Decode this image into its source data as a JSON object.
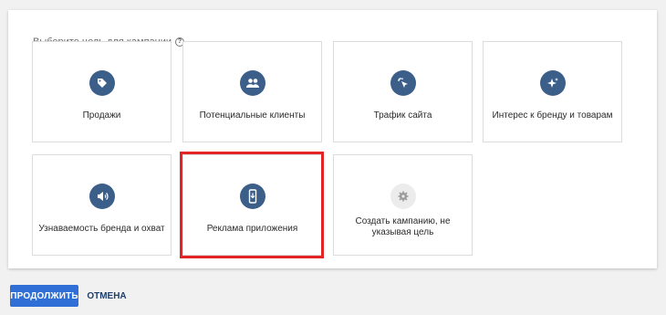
{
  "heading": "Выберите цель для кампании",
  "help_icon": "help-circle-icon",
  "cards": [
    {
      "label": "Продажи",
      "icon": "tag-icon"
    },
    {
      "label": "Потенциальные клиенты",
      "icon": "people-icon"
    },
    {
      "label": "Трафик сайта",
      "icon": "cursor-click-icon"
    },
    {
      "label": "Интерес к бренду и товарам",
      "icon": "sparkle-icon"
    },
    {
      "label": "Узнаваемость бренда и охват",
      "icon": "megaphone-icon"
    },
    {
      "label": "Реклама приложения",
      "icon": "phone-icon"
    },
    {
      "label": "Создать кампанию, не указывая цель",
      "icon": "gear-icon"
    }
  ],
  "colors": {
    "icon_bg": "#3c5f8a",
    "highlight": "#e32424",
    "primary_button": "#2f6fd6"
  },
  "buttons": {
    "continue": "ПРОДОЛЖИТЬ",
    "cancel": "ОТМЕНА"
  }
}
